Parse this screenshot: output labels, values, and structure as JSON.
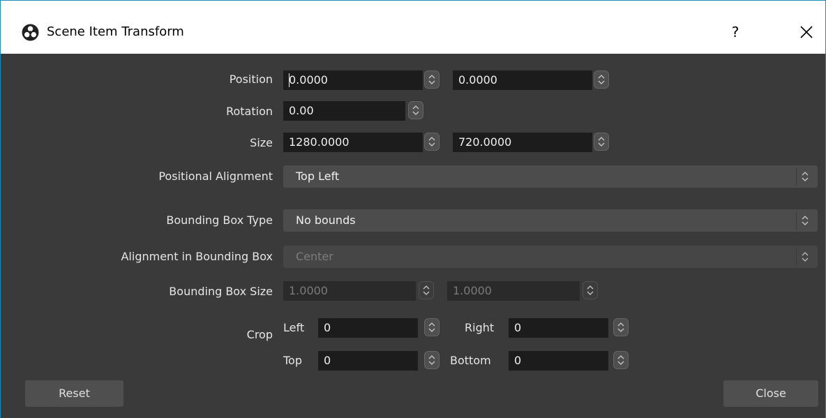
{
  "window": {
    "title": "Scene Item Transform",
    "help_label": "?",
    "close_icon": "close-icon",
    "app_icon": "obs-logo-icon",
    "border_color": "#1e8bb8"
  },
  "position": {
    "label": "Position",
    "x": "0.0000",
    "y": "0.0000"
  },
  "rotation": {
    "label": "Rotation",
    "value": "0.00"
  },
  "size": {
    "label": "Size",
    "width": "1280.0000",
    "height": "720.0000"
  },
  "positional_alignment": {
    "label": "Positional Alignment",
    "value": "Top Left"
  },
  "bounding_box_type": {
    "label": "Bounding Box Type",
    "value": "No bounds"
  },
  "alignment_in_bounding_box": {
    "label": "Alignment in Bounding Box",
    "value": "Center",
    "disabled": true
  },
  "bounding_box_size": {
    "label": "Bounding Box Size",
    "width": "1.0000",
    "height": "1.0000",
    "disabled": true
  },
  "crop": {
    "label": "Crop",
    "left_label": "Left",
    "left": "0",
    "right_label": "Right",
    "right": "0",
    "top_label": "Top",
    "top": "0",
    "bottom_label": "Bottom",
    "bottom": "0"
  },
  "buttons": {
    "reset_label": "Reset",
    "close_label": "Close"
  }
}
